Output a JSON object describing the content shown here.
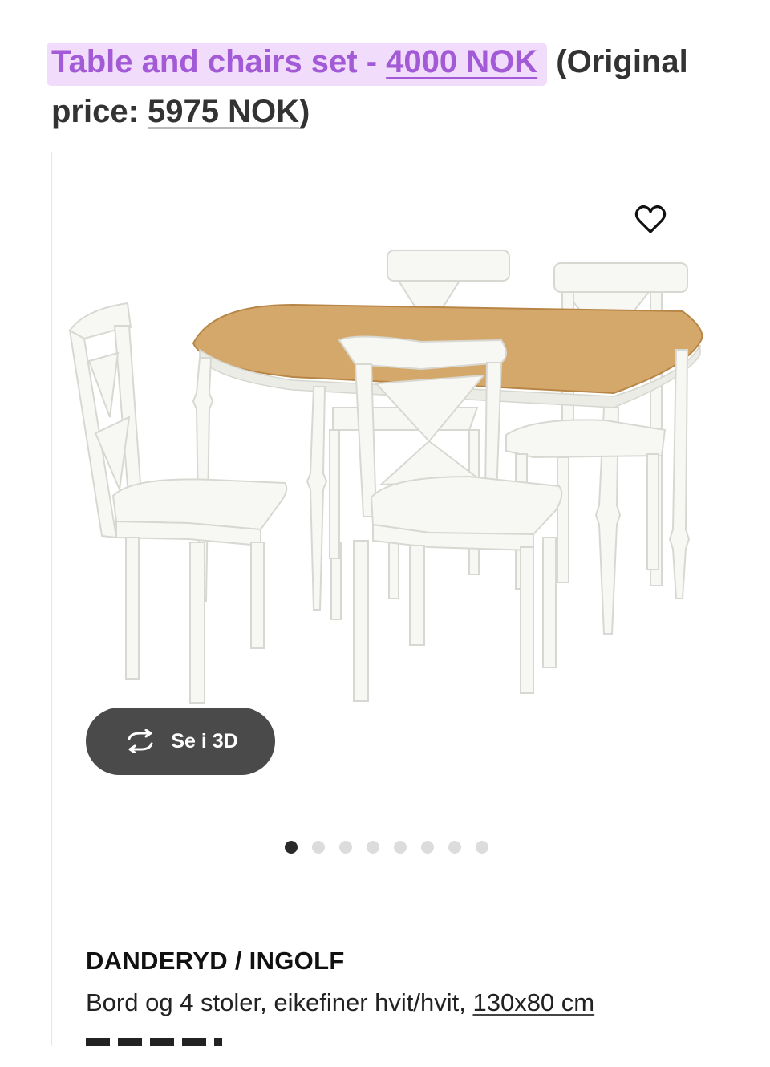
{
  "heading": {
    "highlight_prefix": "Table and chairs set - ",
    "sale_price": "4000 NOK",
    "original_open": " (Original price: ",
    "original_price": "5975 NOK",
    "original_close": ")"
  },
  "card": {
    "view_3d_label": "Se i 3D",
    "image_count": 8,
    "active_image": 1,
    "product_name": "DANDERYD / INGOLF",
    "description": "Bord og 4 stoler, eikefiner hvit/hvit, ",
    "size": "130x80 cm"
  },
  "colors": {
    "highlight_bg": "#f1ddfb",
    "highlight_text": "#a35ad6",
    "button_bg": "#4a4a4a",
    "tabletop": "#d4a86a",
    "furniture": "#f7f7f4"
  },
  "icons": [
    "heart-icon",
    "rotate-3d-icon"
  ]
}
